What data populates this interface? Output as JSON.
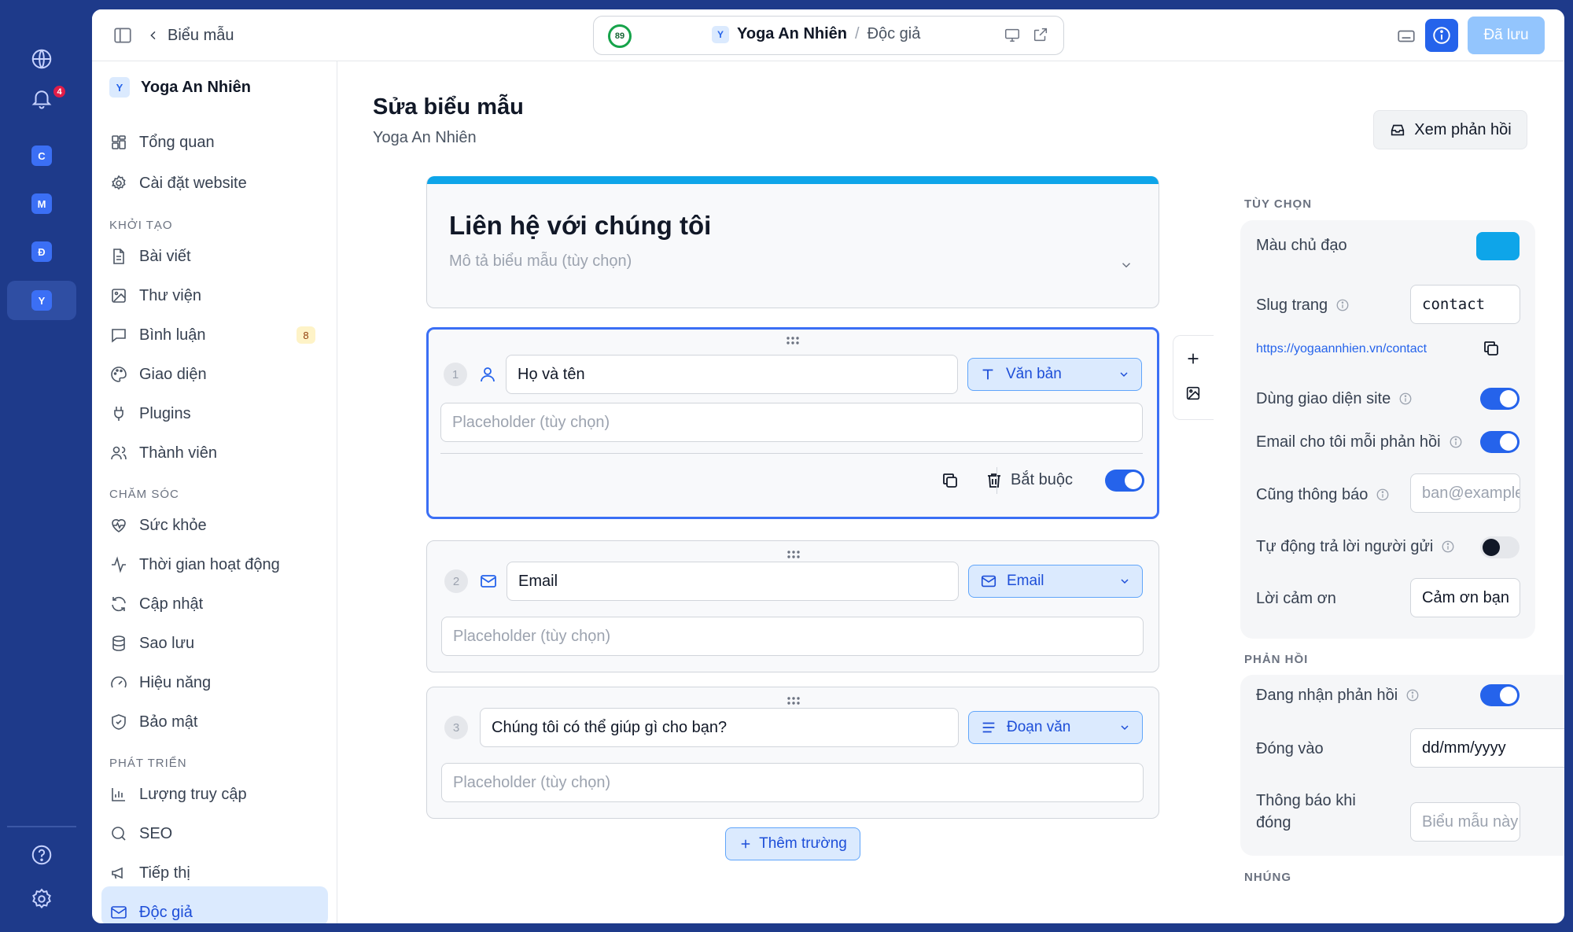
{
  "rail": {
    "notification_count": "4",
    "sites": [
      "C",
      "M",
      "Đ",
      "Y"
    ]
  },
  "topbar": {
    "back_label": "Biểu mẫu",
    "score": "89",
    "site_initial": "Y",
    "site_name": "Yoga An Nhiên",
    "separator": "/",
    "page_name": "Độc giả",
    "saved_label": "Đã lưu"
  },
  "sidebar": {
    "site_initial": "Y",
    "site_name": "Yoga An Nhiên",
    "items": [
      {
        "label": "Tổng quan"
      },
      {
        "label": "Cài đặt website"
      },
      {
        "label": "Bài viết"
      },
      {
        "label": "Thư viện"
      },
      {
        "label": "Bình luận",
        "count": "8"
      },
      {
        "label": "Giao diện"
      },
      {
        "label": "Plugins"
      },
      {
        "label": "Thành viên"
      },
      {
        "label": "Sức khỏe"
      },
      {
        "label": "Thời gian hoạt động"
      },
      {
        "label": "Cập nhật"
      },
      {
        "label": "Sao lưu"
      },
      {
        "label": "Hiệu năng"
      },
      {
        "label": "Bảo mật"
      },
      {
        "label": "Lượng truy cập"
      },
      {
        "label": "SEO"
      },
      {
        "label": "Tiếp thị"
      },
      {
        "label": "Độc giả"
      }
    ],
    "sections": {
      "create": "KHỞI TẠO",
      "care": "CHĂM SÓC",
      "grow": "PHÁT TRIỂN"
    }
  },
  "main": {
    "title": "Sửa biểu mẫu",
    "subtitle": "Yoga An Nhiên",
    "view_responses_label": "Xem phản hồi",
    "form_title": "Liên hệ với chúng tôi",
    "form_description_placeholder": "Mô tả biểu mẫu (tùy chọn)",
    "fields": [
      {
        "number": "1",
        "label": "Họ và tên",
        "type": "Văn bản",
        "placeholder": "Placeholder (tùy chọn)",
        "required_label": "Bắt buộc",
        "required": true
      },
      {
        "number": "2",
        "label": "Email",
        "type": "Email",
        "placeholder": "Placeholder (tùy chọn)"
      },
      {
        "number": "3",
        "label": "Chúng tôi có thể giúp gì cho bạn?",
        "type": "Đoạn văn",
        "placeholder": "Placeholder (tùy chọn)"
      }
    ],
    "add_field_label": "Thêm trường"
  },
  "options": {
    "section_title": "TÙY CHỌN",
    "primary_color_label": "Màu chủ đạo",
    "primary_color": "#0ea5e9",
    "slug_label": "Slug trang",
    "slug_value": "contact",
    "url": "https://yogaannhien.vn/contact",
    "use_site_theme_label": "Dùng giao diện site",
    "use_site_theme": true,
    "email_me_label": "Email cho tôi mỗi phản hồi",
    "email_me": true,
    "also_notify_label": "Cũng thông báo",
    "also_notify_placeholder": "ban@example.com",
    "auto_reply_label": "Tự động trả lời người gửi",
    "auto_reply": false,
    "thanks_label": "Lời cảm ơn",
    "thanks_value": "Cảm ơn bạn"
  },
  "responses": {
    "section_title": "PHẢN HỒI",
    "accepting_label": "Đang nhận phản hồi",
    "accepting": true,
    "close_on_label": "Đóng vào",
    "close_on_placeholder": "dd/mm/yyyy",
    "closed_message_label": "Thông báo khi đóng",
    "closed_message_placeholder": "Biểu mẫu này đã đóng"
  },
  "embed": {
    "section_title": "NHÚNG"
  }
}
